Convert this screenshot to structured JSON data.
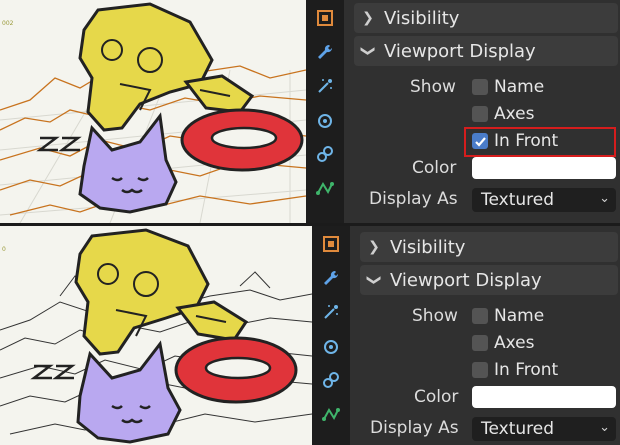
{
  "top": {
    "sections": {
      "visibility": "Visibility",
      "viewport_display": "Viewport Display"
    },
    "labels": {
      "show": "Show",
      "color": "Color",
      "display_as": "Display As"
    },
    "checkboxes": {
      "name": {
        "label": "Name",
        "checked": false
      },
      "axes": {
        "label": "Axes",
        "checked": false
      },
      "in_front": {
        "label": "In Front",
        "checked": true
      }
    },
    "color_value": "#ffffff",
    "display_as_value": "Textured",
    "corner_text": "002"
  },
  "bottom": {
    "sections": {
      "visibility": "Visibility",
      "viewport_display": "Viewport Display"
    },
    "labels": {
      "show": "Show",
      "color": "Color",
      "display_as": "Display As"
    },
    "checkboxes": {
      "name": {
        "label": "Name",
        "checked": false
      },
      "axes": {
        "label": "Axes",
        "checked": false
      },
      "in_front": {
        "label": "In Front",
        "checked": false
      }
    },
    "color_value": "#ffffff",
    "display_as_value": "Textured",
    "corner_text": "0"
  },
  "sidebar_icons": [
    "object-icon",
    "wrench-icon",
    "particles-icon",
    "physics-icon",
    "constraints-icon",
    "data-icon"
  ],
  "colors": {
    "highlight": "#d51d1d",
    "checkbox_checked": "#4a7cc9",
    "monkey": "#e6d84a",
    "torus": "#e0343a",
    "cat": "#b9a8f0"
  }
}
